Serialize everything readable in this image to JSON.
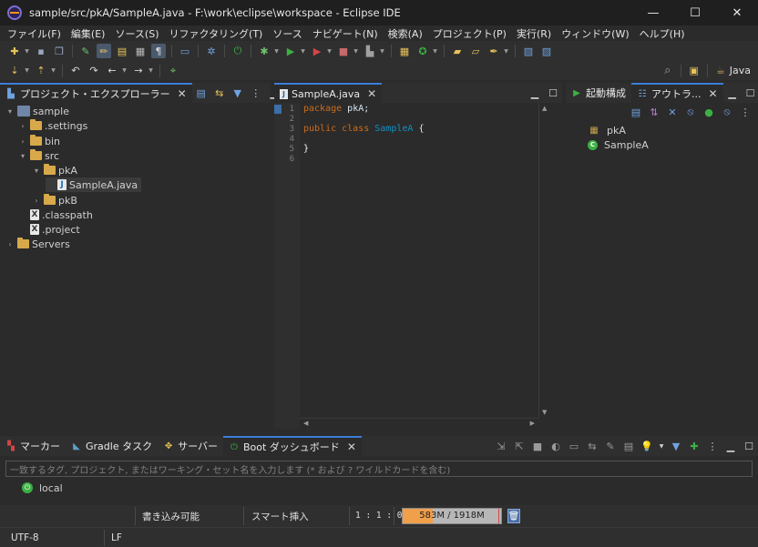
{
  "window": {
    "title": "sample/src/pkA/SampleA.java - F:\\work\\eclipse\\workspace - Eclipse IDE",
    "minimize": "—",
    "maximize": "☐",
    "close": "✕"
  },
  "menu": [
    "ファイル(F)",
    "編集(E)",
    "ソース(S)",
    "リファクタリング(T)",
    "ソース",
    "ナビゲート(N)",
    "検索(A)",
    "プロジェクト(P)",
    "実行(R)",
    "ウィンドウ(W)",
    "ヘルプ(H)"
  ],
  "toolbar": {
    "perspective_label": "Java"
  },
  "project_explorer": {
    "tab_label": "プロジェクト・エクスプローラー",
    "close": "✕",
    "tree": [
      {
        "label": "sample",
        "arrow": "▾",
        "icon": "project-icon"
      },
      {
        "label": ".settings",
        "arrow": "›",
        "icon": "folder-icon"
      },
      {
        "label": "bin",
        "arrow": "›",
        "icon": "folder-icon"
      },
      {
        "label": "src",
        "arrow": "▾",
        "icon": "folder-icon"
      },
      {
        "label": "pkA",
        "arrow": "▾",
        "icon": "folder-icon"
      },
      {
        "label": "SampleA.java",
        "arrow": "",
        "icon": "java-file-icon"
      },
      {
        "label": "pkB",
        "arrow": "›",
        "icon": "folder-icon"
      },
      {
        "label": ".classpath",
        "arrow": "",
        "icon": "x-file-icon"
      },
      {
        "label": ".project",
        "arrow": "",
        "icon": "x-file-icon"
      },
      {
        "label": "Servers",
        "arrow": "›",
        "icon": "folder-icon"
      }
    ]
  },
  "editor": {
    "tab_label": "SampleA.java",
    "close": "✕",
    "line_numbers": [
      "1",
      "2",
      "3",
      "4",
      "5",
      "6"
    ],
    "code": {
      "l1_kw": "package",
      "l1_rest": " pkA;",
      "l3_kw": "public class",
      "l3_type": " SampleA",
      "l3_rest": " {",
      "l5": "}"
    }
  },
  "outline": {
    "tab1_label": "起動構成",
    "tab2_label": "アウトラ...",
    "close": "✕",
    "items": [
      {
        "label": "pkA",
        "icon": "package-icon"
      },
      {
        "label": "SampleA",
        "icon": "class-icon"
      }
    ]
  },
  "bottom_panel": {
    "tabs": [
      {
        "label": "マーカー",
        "icon": "marker-icon"
      },
      {
        "label": "Gradle タスク",
        "icon": "gradle-icon"
      },
      {
        "label": "サーバー",
        "icon": "server-icon"
      },
      {
        "label": "Boot ダッシュボード",
        "icon": "boot-dashboard-icon"
      }
    ],
    "close": "✕",
    "filter_placeholder": "一致するタグ, プロジェクト, またはワーキング・セット名を入力します (* および ? ワイルドカードを含む)",
    "items": [
      {
        "label": "local",
        "icon": "boot-local-icon"
      }
    ]
  },
  "status": {
    "writable": "書き込み可能",
    "insert_mode": "スマート挿入",
    "position": "1 : 1 : 0",
    "heap": "583M / 1918M",
    "heap_used_fraction": 0.304,
    "encoding": "UTF-8",
    "line_delimiter": "LF"
  },
  "colors": {
    "accent": "#3b7dd8",
    "background": "#2b2b2b",
    "keyword": "#cc6c1d",
    "type": "#1290c3",
    "heap_fill": "#f0a04b",
    "boot_green": "#3cb043"
  }
}
